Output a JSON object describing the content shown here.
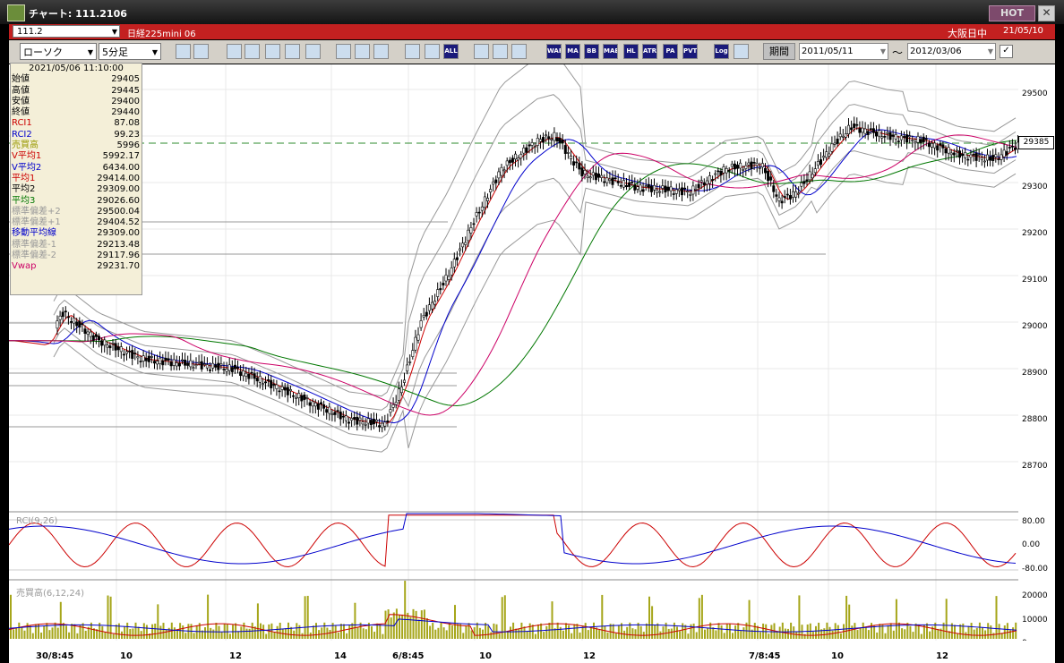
{
  "window": {
    "title": "チャート: 111.2106",
    "hot_label": "HOT",
    "close_glyph": "✕"
  },
  "header": {
    "symbol": "111.2",
    "instrument": "日経225mini 06",
    "session": "大阪日中",
    "date": "21/05/10"
  },
  "toolbar": {
    "chart_type": "ローソク",
    "interval": "5分足",
    "icons": [
      "zoom-icon",
      "cursor-icon",
      "bar-icon",
      "search-icon",
      "chart-icon",
      "cross-icon",
      "alert-icon",
      "pencil-icon",
      "arrow-icon",
      "flag-icon",
      "candle-icon",
      "candle2-icon",
      "all-icon",
      "settings-icon",
      "brush-icon",
      "palette-icon",
      "wap-icon",
      "ma-icon",
      "bb-icon",
      "mae-icon",
      "hl-icon",
      "atr-icon",
      "para-icon",
      "pvt-icon",
      "log-icon",
      "screen-icon"
    ],
    "icon_labels": {
      "all": "ALL",
      "wap": "WAP",
      "ma": "MA",
      "bb": "BB",
      "mae": "MAE",
      "hl": "HL",
      "atr": "ATR",
      "para": "PA RA",
      "pvt": "PVT",
      "log": "Log"
    },
    "period_label": "期間",
    "date_from": "2011/05/11",
    "tilde": "〜",
    "date_to": "2012/03/06"
  },
  "info_box": {
    "timestamp": "2021/05/06 11:10:00",
    "rows": [
      {
        "label": "始値",
        "value": "29405",
        "color": "#000000"
      },
      {
        "label": "高値",
        "value": "29445",
        "color": "#000000"
      },
      {
        "label": "安値",
        "value": "29400",
        "color": "#000000"
      },
      {
        "label": "終値",
        "value": "29440",
        "color": "#000000"
      },
      {
        "label": "RCI1",
        "value": "87.08",
        "color": "#cc0000"
      },
      {
        "label": "RCI2",
        "value": "99.23",
        "color": "#0000cc"
      },
      {
        "label": "売買高",
        "value": "5996",
        "color": "#999900"
      },
      {
        "label": "V平均1",
        "value": "5992.17",
        "color": "#cc0000"
      },
      {
        "label": "V平均2",
        "value": "6434.00",
        "color": "#0000cc"
      },
      {
        "label": "平均1",
        "value": "29414.00",
        "color": "#cc0000"
      },
      {
        "label": "平均2",
        "value": "29309.00",
        "color": "#000000"
      },
      {
        "label": "平均3",
        "value": "29026.60",
        "color": "#007700"
      },
      {
        "label": "標準偏差+2",
        "value": "29500.04",
        "color": "#999999"
      },
      {
        "label": "標準偏差+1",
        "value": "29404.52",
        "color": "#999999"
      },
      {
        "label": "移動平均線",
        "value": "29309.00",
        "color": "#0000cc"
      },
      {
        "label": "標準偏差-1",
        "value": "29213.48",
        "color": "#999999"
      },
      {
        "label": "標準偏差-2",
        "value": "29117.96",
        "color": "#999999"
      },
      {
        "label": "Vwap",
        "value": "29231.70",
        "color": "#cc0066"
      }
    ]
  },
  "price_panel": {
    "y_ticks": [
      "29500",
      "29400",
      "29300",
      "29200",
      "29100",
      "29000",
      "28900",
      "28800",
      "28700"
    ],
    "last_price_tag": "29385"
  },
  "rci_panel": {
    "label": "RCI(9,26)",
    "y_ticks": [
      "80.00",
      "0.00",
      "-80.00"
    ]
  },
  "volume_panel": {
    "label": "売買高(6,12,24)",
    "y_ticks": [
      "20000",
      "10000",
      "0"
    ]
  },
  "x_axis": {
    "labels": [
      "30/8:45",
      "10",
      "12",
      "14",
      "6/8:45",
      "10",
      "12",
      "7/8:45",
      "10",
      "12"
    ]
  },
  "colors": {
    "title_bar": "#1e1e1e",
    "red_bar": "#c32020",
    "toolbar": "#d4d0c8",
    "bull": "#ffffff",
    "bear": "#000000",
    "ma_blue": "#0000cc",
    "ma_red": "#cc0000",
    "ma_green": "#007700",
    "vwap": "#cc0066",
    "band": "#999999",
    "volume": "#a6a61a"
  }
}
